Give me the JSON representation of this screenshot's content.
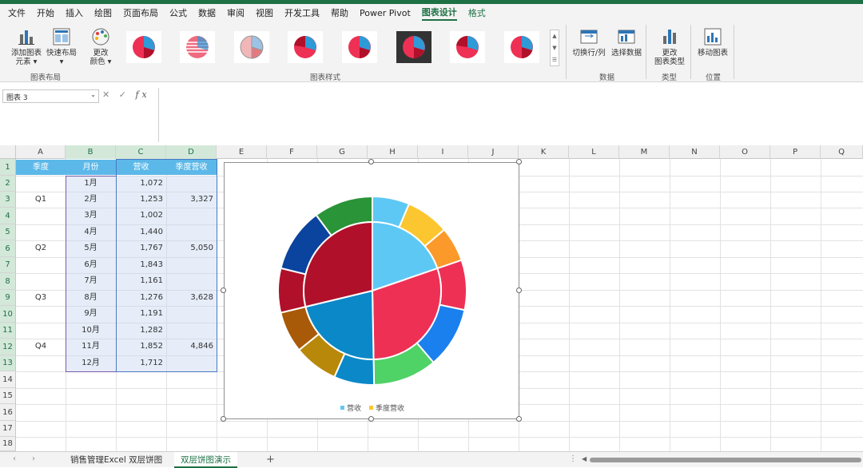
{
  "menu": [
    "文件",
    "开始",
    "插入",
    "绘图",
    "页面布局",
    "公式",
    "数据",
    "审阅",
    "视图",
    "开发工具",
    "帮助",
    "Power Pivot",
    "图表设计",
    "格式"
  ],
  "ribbon": {
    "add_element": "添加图表\n元素 ▾",
    "quick_layout": "快速布局\n▾",
    "change_colors": "更改\n颜色 ▾",
    "switch_rowcol": "切换行/列",
    "select_data": "选择数据",
    "change_type": "更改\n图表类型",
    "move_chart": "移动图表",
    "group_layouts": "图表布局",
    "group_styles": "图表样式",
    "group_data": "数据",
    "group_type": "类型",
    "group_location": "位置"
  },
  "formula_bar": {
    "name_box": "图表 3",
    "fx": "fx",
    "cancel": "✕",
    "confirm": "✓"
  },
  "columns": [
    "A",
    "B",
    "C",
    "D",
    "E",
    "F",
    "G",
    "H",
    "I",
    "J",
    "K",
    "L",
    "M",
    "N",
    "O",
    "P",
    "Q"
  ],
  "rows": [
    "1",
    "2",
    "3",
    "4",
    "5",
    "6",
    "7",
    "8",
    "9",
    "10",
    "11",
    "12",
    "13",
    "14",
    "15",
    "16",
    "17",
    "18"
  ],
  "table": {
    "headers": [
      "季度",
      "月份",
      "营收",
      "季度营收"
    ],
    "quarters": [
      "Q1",
      "Q2",
      "Q3",
      "Q4"
    ],
    "months": [
      "1月",
      "2月",
      "3月",
      "4月",
      "5月",
      "6月",
      "7月",
      "8月",
      "9月",
      "10月",
      "11月",
      "12月"
    ],
    "revenue": [
      "1,072",
      "1,253",
      "1,002",
      "1,440",
      "1,767",
      "1,843",
      "1,161",
      "1,276",
      "1,191",
      "1,282",
      "1,852",
      "1,712"
    ],
    "quarter_revenue": [
      "3,327",
      "5,050",
      "3,628",
      "4,846"
    ]
  },
  "chart_data": {
    "type": "pie",
    "title": "",
    "series": [
      {
        "name": "营收",
        "categories": [
          "1月",
          "2月",
          "3月",
          "4月",
          "5月",
          "6月",
          "7月",
          "8月",
          "9月",
          "10月",
          "11月",
          "12月"
        ],
        "values": [
          1072,
          1253,
          1002,
          1440,
          1767,
          1843,
          1161,
          1276,
          1191,
          1282,
          1852,
          1712
        ]
      },
      {
        "name": "季度营收",
        "categories": [
          "Q1",
          "Q2",
          "Q3",
          "Q4"
        ],
        "values": [
          3327,
          5050,
          3628,
          4846
        ]
      }
    ],
    "legend": "bottom",
    "legend_entries": [
      "营收",
      "季度营收"
    ],
    "outer_colors": [
      "#5ec8f5",
      "#fcc630",
      "#fb9a2b",
      "#ee3054",
      "#1a80ee",
      "#4fd266",
      "#0a88c8",
      "#b8880a",
      "#a85a08",
      "#b0102a",
      "#0a449e",
      "#2a9438"
    ],
    "inner_colors": [
      "#5ec8f5",
      "#ee3054",
      "#0a88c8",
      "#b0102a"
    ],
    "legend_colors": [
      "#5ec8f5",
      "#fcc630"
    ]
  },
  "sheets": [
    "销售管理Excel 双层饼图",
    "双层饼图演示"
  ],
  "accent": "#1e7145"
}
